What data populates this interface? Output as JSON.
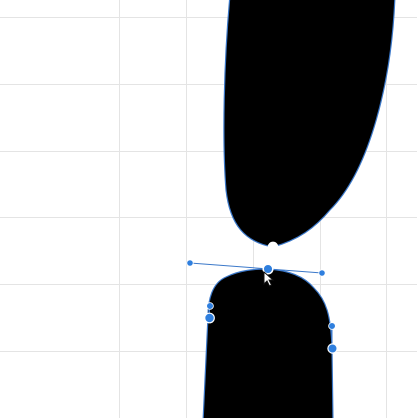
{
  "colors": {
    "background": "#ffffff",
    "grid": "#e4e4e4",
    "glyph_fill": "#000000",
    "outline": "#3b78c9",
    "anchor": "#2f7fde",
    "handle_line": "#3b78c9",
    "cursor_fill": "#ffffff",
    "cursor_stroke": "#111111"
  },
  "icons": {
    "cursor": "mouse-pointer-arrow-icon"
  }
}
